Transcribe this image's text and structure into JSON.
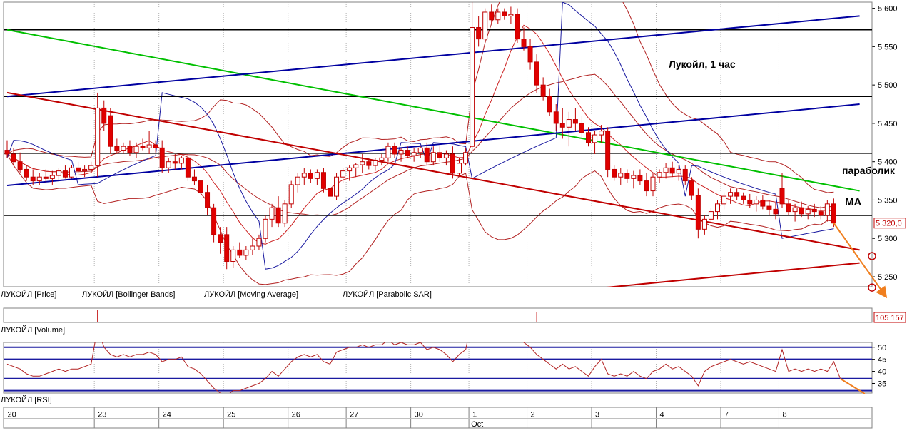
{
  "chart_data": {
    "type": "candlestick",
    "title": "Лукойл,  1 час",
    "annotations": [
      "параболик",
      "MA"
    ],
    "price_axis": {
      "ticks": [
        "5 600",
        "5 550",
        "5 500",
        "5 450",
        "5 400",
        "5 350",
        "5 300",
        "5 250"
      ],
      "tick_values": [
        5600,
        5550,
        5500,
        5450,
        5400,
        5350,
        5300,
        5250
      ],
      "range": [
        5237,
        5608
      ]
    },
    "last_price_label": "5 320,0",
    "legend": [
      "ЛУКОЙЛ [Price]",
      "ЛУКОЙЛ [Bollinger Bands]",
      "ЛУКОЙЛ [Moving Average]",
      "ЛУКОЙЛ [Parabolic SAR]"
    ],
    "volume_label": "ЛУКОЙЛ [Volume]",
    "volume_value": "105 157",
    "rsi_label": "ЛУКОЙЛ [RSI]",
    "rsi_axis": {
      "ticks": [
        "50",
        "45",
        "40",
        "35"
      ],
      "tick_values": [
        50,
        45,
        40,
        35
      ],
      "range": [
        31,
        52
      ]
    },
    "rsi_levels": [
      50,
      45,
      37,
      32
    ],
    "x_axis": {
      "days": [
        "20",
        "23",
        "24",
        "25",
        "26",
        "27",
        "30",
        "1",
        "2",
        "3",
        "4",
        "7",
        "8"
      ],
      "day_start_index": [
        0,
        14,
        24,
        34,
        44,
        53,
        63,
        72,
        81,
        91,
        101,
        111,
        120
      ],
      "month_label": "Oct",
      "month_label_day": "1"
    },
    "horizontal_levels": [
      5572,
      5485,
      5411,
      5330,
      5234
    ],
    "trendlines": [
      {
        "color": "#00c000",
        "from": [
          0,
          5572
        ],
        "to": [
          132,
          5362
        ]
      },
      {
        "color": "#0000a0",
        "from": [
          0,
          5485
        ],
        "to": [
          132,
          5590
        ]
      },
      {
        "color": "#0000a0",
        "from": [
          0,
          5369
        ],
        "to": [
          132,
          5475
        ]
      },
      {
        "color": "#c00000",
        "from": [
          0,
          5490
        ],
        "to": [
          132,
          5285
        ]
      },
      {
        "color": "#c00000",
        "from": [
          89,
          5233
        ],
        "to": [
          132,
          5268
        ]
      }
    ],
    "forecast_arrows": [
      {
        "from": [
          128,
          5320
        ],
        "to": [
          136,
          5225
        ]
      }
    ],
    "target_circles": [
      5277,
      5236
    ],
    "candles": [
      [
        5415,
        5428,
        5405,
        5410
      ],
      [
        5410,
        5418,
        5395,
        5400
      ],
      [
        5400,
        5412,
        5385,
        5390
      ],
      [
        5390,
        5395,
        5375,
        5380
      ],
      [
        5380,
        5390,
        5370,
        5375
      ],
      [
        5375,
        5385,
        5370,
        5380
      ],
      [
        5380,
        5390,
        5372,
        5378
      ],
      [
        5378,
        5388,
        5370,
        5382
      ],
      [
        5382,
        5392,
        5375,
        5388
      ],
      [
        5388,
        5395,
        5378,
        5380
      ],
      [
        5380,
        5396,
        5378,
        5392
      ],
      [
        5392,
        5400,
        5384,
        5388
      ],
      [
        5388,
        5395,
        5380,
        5390
      ],
      [
        5390,
        5400,
        5385,
        5395
      ],
      [
        5395,
        5490,
        5380,
        5470
      ],
      [
        5470,
        5480,
        5440,
        5450
      ],
      [
        5460,
        5470,
        5410,
        5420
      ],
      [
        5420,
        5430,
        5410,
        5415
      ],
      [
        5415,
        5425,
        5410,
        5420
      ],
      [
        5420,
        5428,
        5408,
        5412
      ],
      [
        5412,
        5425,
        5405,
        5420
      ],
      [
        5420,
        5430,
        5415,
        5418
      ],
      [
        5418,
        5440,
        5410,
        5422
      ],
      [
        5422,
        5428,
        5412,
        5418
      ],
      [
        5418,
        5428,
        5385,
        5392
      ],
      [
        5392,
        5405,
        5385,
        5400
      ],
      [
        5400,
        5410,
        5390,
        5398
      ],
      [
        5398,
        5408,
        5390,
        5405
      ],
      [
        5405,
        5410,
        5375,
        5380
      ],
      [
        5380,
        5390,
        5370,
        5375
      ],
      [
        5375,
        5385,
        5355,
        5360
      ],
      [
        5360,
        5370,
        5330,
        5340
      ],
      [
        5340,
        5345,
        5295,
        5305
      ],
      [
        5305,
        5315,
        5280,
        5295
      ],
      [
        5305,
        5315,
        5260,
        5270
      ],
      [
        5270,
        5290,
        5262,
        5285
      ],
      [
        5285,
        5295,
        5275,
        5278
      ],
      [
        5278,
        5290,
        5272,
        5285
      ],
      [
        5285,
        5300,
        5278,
        5290
      ],
      [
        5290,
        5305,
        5285,
        5300
      ],
      [
        5300,
        5330,
        5295,
        5325
      ],
      [
        5325,
        5345,
        5315,
        5340
      ],
      [
        5340,
        5355,
        5315,
        5320
      ],
      [
        5320,
        5350,
        5315,
        5345
      ],
      [
        5345,
        5375,
        5340,
        5370
      ],
      [
        5370,
        5385,
        5360,
        5380
      ],
      [
        5380,
        5392,
        5370,
        5385
      ],
      [
        5385,
        5390,
        5372,
        5378
      ],
      [
        5378,
        5390,
        5370,
        5386
      ],
      [
        5386,
        5392,
        5360,
        5365
      ],
      [
        5365,
        5375,
        5348,
        5355
      ],
      [
        5355,
        5385,
        5350,
        5380
      ],
      [
        5380,
        5392,
        5372,
        5388
      ],
      [
        5388,
        5395,
        5375,
        5392
      ],
      [
        5392,
        5398,
        5380,
        5396
      ],
      [
        5396,
        5410,
        5385,
        5400
      ],
      [
        5400,
        5405,
        5390,
        5395
      ],
      [
        5395,
        5405,
        5388,
        5402
      ],
      [
        5402,
        5410,
        5395,
        5405
      ],
      [
        5405,
        5425,
        5400,
        5420
      ],
      [
        5420,
        5425,
        5405,
        5410
      ],
      [
        5410,
        5418,
        5400,
        5415
      ],
      [
        5415,
        5420,
        5405,
        5408
      ],
      [
        5408,
        5418,
        5400,
        5412
      ],
      [
        5412,
        5420,
        5405,
        5418
      ],
      [
        5418,
        5425,
        5395,
        5400
      ],
      [
        5400,
        5420,
        5395,
        5412
      ],
      [
        5412,
        5420,
        5400,
        5405
      ],
      [
        5405,
        5415,
        5395,
        5410
      ],
      [
        5410,
        5420,
        5378,
        5385
      ],
      [
        5385,
        5405,
        5380,
        5398
      ],
      [
        5398,
        5418,
        5395,
        5412
      ],
      [
        5420,
        5608,
        5415,
        5575
      ],
      [
        5575,
        5590,
        5550,
        5560
      ],
      [
        5560,
        5600,
        5555,
        5595
      ],
      [
        5595,
        5605,
        5580,
        5585
      ],
      [
        5585,
        5600,
        5580,
        5595
      ],
      [
        5595,
        5600,
        5585,
        5590
      ],
      [
        5590,
        5602,
        5580,
        5592
      ],
      [
        5592,
        5600,
        5555,
        5560
      ],
      [
        5560,
        5575,
        5545,
        5550
      ],
      [
        5550,
        5560,
        5520,
        5530
      ],
      [
        5530,
        5540,
        5490,
        5500
      ],
      [
        5500,
        5510,
        5480,
        5485
      ],
      [
        5485,
        5495,
        5460,
        5465
      ],
      [
        5465,
        5475,
        5440,
        5450
      ],
      [
        5450,
        5470,
        5430,
        5445
      ],
      [
        5445,
        5465,
        5420,
        5455
      ],
      [
        5455,
        5470,
        5440,
        5450
      ],
      [
        5450,
        5460,
        5430,
        5438
      ],
      [
        5438,
        5445,
        5420,
        5425
      ],
      [
        5425,
        5440,
        5410,
        5435
      ],
      [
        5435,
        5448,
        5425,
        5440
      ],
      [
        5440,
        5445,
        5380,
        5390
      ],
      [
        5390,
        5395,
        5375,
        5380
      ],
      [
        5380,
        5392,
        5370,
        5385
      ],
      [
        5385,
        5390,
        5372,
        5378
      ],
      [
        5378,
        5388,
        5365,
        5382
      ],
      [
        5382,
        5390,
        5370,
        5375
      ],
      [
        5375,
        5385,
        5355,
        5362
      ],
      [
        5362,
        5385,
        5355,
        5380
      ],
      [
        5380,
        5390,
        5372,
        5386
      ],
      [
        5386,
        5398,
        5378,
        5392
      ],
      [
        5392,
        5400,
        5380,
        5385
      ],
      [
        5385,
        5395,
        5375,
        5390
      ],
      [
        5390,
        5395,
        5370,
        5375
      ],
      [
        5375,
        5380,
        5350,
        5356
      ],
      [
        5356,
        5365,
        5300,
        5312
      ],
      [
        5312,
        5330,
        5305,
        5325
      ],
      [
        5325,
        5340,
        5318,
        5335
      ],
      [
        5335,
        5350,
        5325,
        5345
      ],
      [
        5345,
        5360,
        5338,
        5355
      ],
      [
        5355,
        5365,
        5345,
        5360
      ],
      [
        5360,
        5365,
        5350,
        5355
      ],
      [
        5355,
        5360,
        5345,
        5350
      ],
      [
        5350,
        5358,
        5340,
        5345
      ],
      [
        5345,
        5355,
        5335,
        5350
      ],
      [
        5350,
        5356,
        5338,
        5342
      ],
      [
        5342,
        5350,
        5330,
        5338
      ],
      [
        5338,
        5346,
        5325,
        5332
      ],
      [
        5365,
        5385,
        5340,
        5345
      ],
      [
        5345,
        5350,
        5330,
        5335
      ],
      [
        5335,
        5345,
        5322,
        5340
      ],
      [
        5340,
        5348,
        5328,
        5332
      ],
      [
        5332,
        5342,
        5325,
        5338
      ],
      [
        5338,
        5345,
        5328,
        5335
      ],
      [
        5335,
        5342,
        5325,
        5330
      ],
      [
        5330,
        5350,
        5322,
        5345
      ],
      [
        5345,
        5352,
        5315,
        5320
      ]
    ],
    "volume_spikes": [
      [
        14,
        0.9
      ],
      [
        82,
        0.7
      ]
    ],
    "rsi_values": [
      43,
      42,
      41,
      39,
      38,
      38,
      39,
      40,
      41,
      40,
      41,
      41,
      42,
      43,
      58,
      50,
      47,
      46,
      47,
      46,
      47,
      47,
      48,
      47,
      44,
      45,
      45,
      46,
      42,
      41,
      39,
      36,
      33,
      31,
      30,
      32,
      32,
      33,
      34,
      35,
      37,
      40,
      38,
      41,
      44,
      46,
      47,
      46,
      47,
      44,
      43,
      48,
      49,
      50,
      50,
      51,
      50,
      51,
      51,
      53,
      51,
      52,
      51,
      51,
      52,
      49,
      50,
      49,
      47,
      44,
      47,
      49,
      62,
      57,
      61,
      59,
      60,
      59,
      60,
      55,
      52,
      50,
      47,
      45,
      43,
      41,
      43,
      41,
      42,
      40,
      38,
      42,
      45,
      39,
      38,
      39,
      38,
      40,
      38,
      37,
      40,
      41,
      43,
      41,
      42,
      40,
      38,
      34,
      40,
      42,
      43,
      44,
      45,
      44,
      43,
      44,
      43,
      42,
      41,
      40,
      49,
      40,
      41,
      40,
      41,
      40,
      41,
      40,
      44,
      37
    ]
  }
}
